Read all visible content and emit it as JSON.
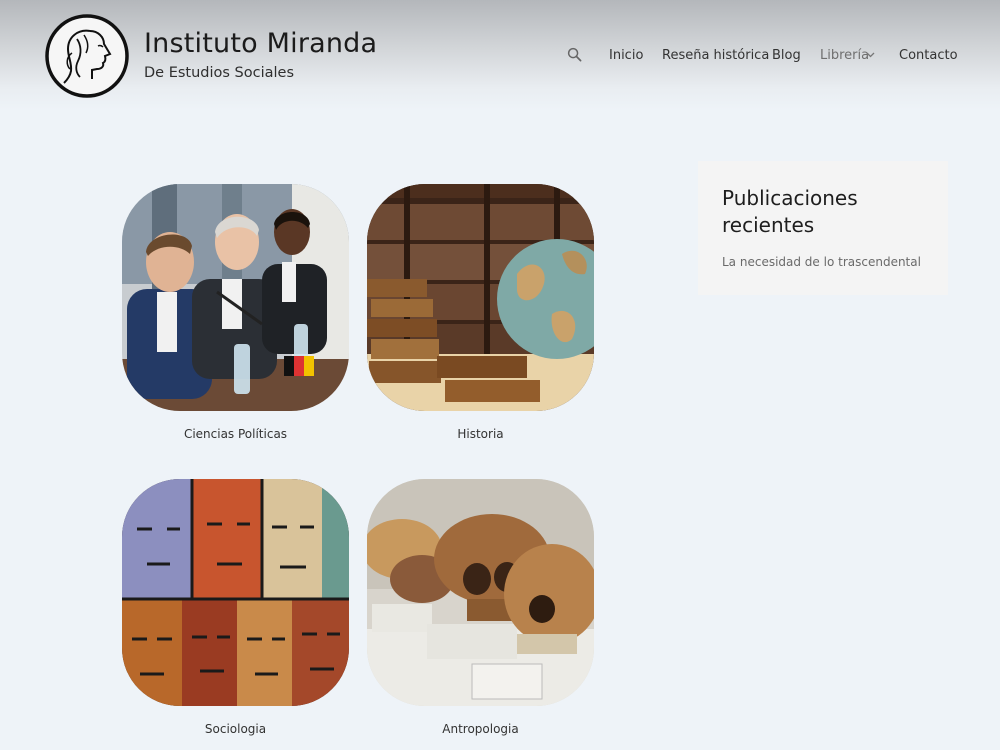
{
  "header": {
    "title": "Instituto Miranda",
    "tagline": "De Estudios Sociales",
    "logo_icon": "woman-profile-logo-icon",
    "search_icon": "search-icon"
  },
  "nav": {
    "items": [
      {
        "label": "Inicio"
      },
      {
        "label": "Reseña histórica"
      },
      {
        "label": "Blog"
      },
      {
        "label": "Librería",
        "has_dropdown": true
      },
      {
        "label": "Contacto"
      }
    ]
  },
  "categories": [
    {
      "label": "Ciencias Políticas"
    },
    {
      "label": "Historia"
    },
    {
      "label": "Sociologia"
    },
    {
      "label": "Antropologia"
    }
  ],
  "sidebar": {
    "widget_title": "Publicaciones recientes",
    "posts": [
      {
        "title": "La necesidad de lo trascendental"
      }
    ]
  },
  "colors": {
    "page_bg": "#eef3f8",
    "header_top": "#b4b7bb",
    "widget_bg": "#f4f4f4",
    "text": "#333333"
  }
}
